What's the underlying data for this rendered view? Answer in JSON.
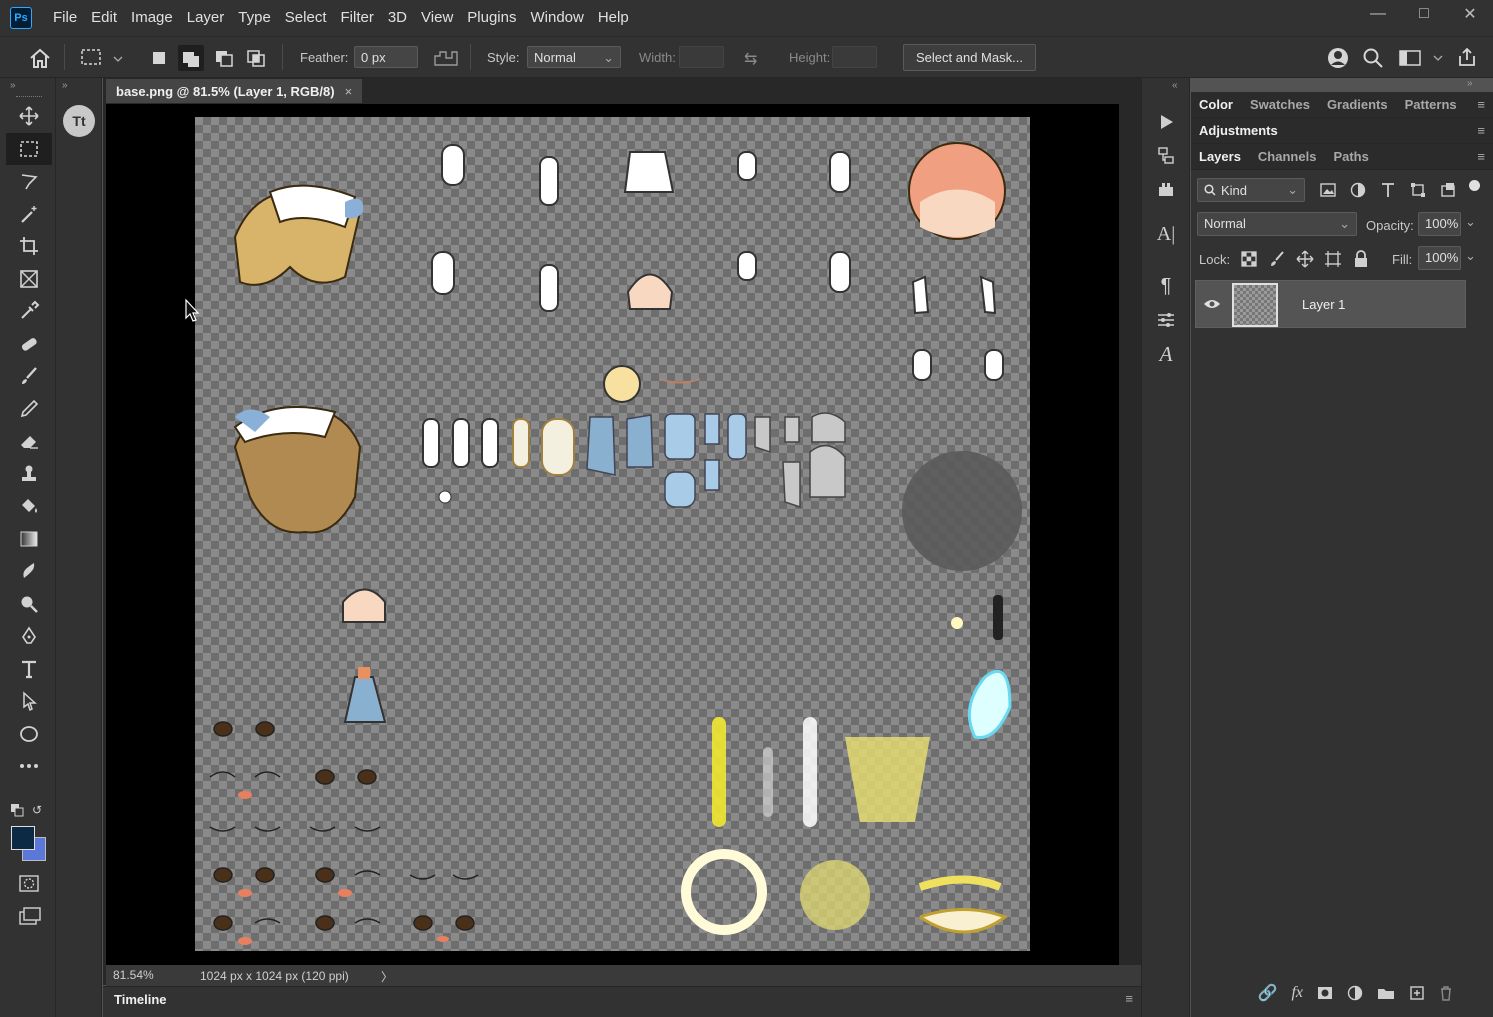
{
  "app": {
    "logo": "Ps"
  },
  "menu": [
    "File",
    "Edit",
    "Image",
    "Layer",
    "Type",
    "Select",
    "Filter",
    "3D",
    "View",
    "Plugins",
    "Window",
    "Help"
  ],
  "window_controls": {
    "minimize": "—",
    "maximize": "□",
    "close": "✕"
  },
  "options_bar": {
    "feather_label": "Feather:",
    "feather_value": "0 px",
    "style_label": "Style:",
    "style_value": "Normal",
    "width_label": "Width:",
    "height_label": "Height:",
    "select_mask_label": "Select and Mask..."
  },
  "document": {
    "tab_title": "base.png @ 81.5% (Layer 1, RGB/8)",
    "close_glyph": "×"
  },
  "status": {
    "zoom": "81.54%",
    "info": "1024 px x 1024 px (120 ppi)",
    "arrow": "〉"
  },
  "timeline": {
    "label": "Timeline"
  },
  "tools": [
    "move-tool",
    "rectangular-marquee-tool",
    "lasso-tool",
    "magic-wand-tool",
    "crop-tool",
    "frame-tool",
    "eyedropper-tool",
    "healing-brush-tool",
    "brush-tool",
    "pencil-tool",
    "eraser-tool",
    "clone-stamp-tool",
    "paint-bucket-tool",
    "gradient-tool",
    "smudge-tool",
    "dodge-tool",
    "pen-tool",
    "type-tool",
    "path-selection-tool",
    "ellipse-tool",
    "more-tools"
  ],
  "colors": {
    "foreground": "#0d2a44",
    "background": "#5a77d9",
    "accent": "#31a8ff"
  },
  "panels": {
    "color_tabs": [
      "Color",
      "Swatches",
      "Gradients",
      "Patterns"
    ],
    "adjustments": "Adjustments",
    "layers_tabs": [
      "Layers",
      "Channels",
      "Paths"
    ],
    "kind_label": "Kind",
    "blend_mode": "Normal",
    "opacity_label": "Opacity:",
    "opacity_value": "100%",
    "lock_label": "Lock:",
    "fill_label": "Fill:",
    "fill_value": "100%",
    "layers": [
      {
        "name": "Layer 1",
        "visible": true
      }
    ]
  }
}
